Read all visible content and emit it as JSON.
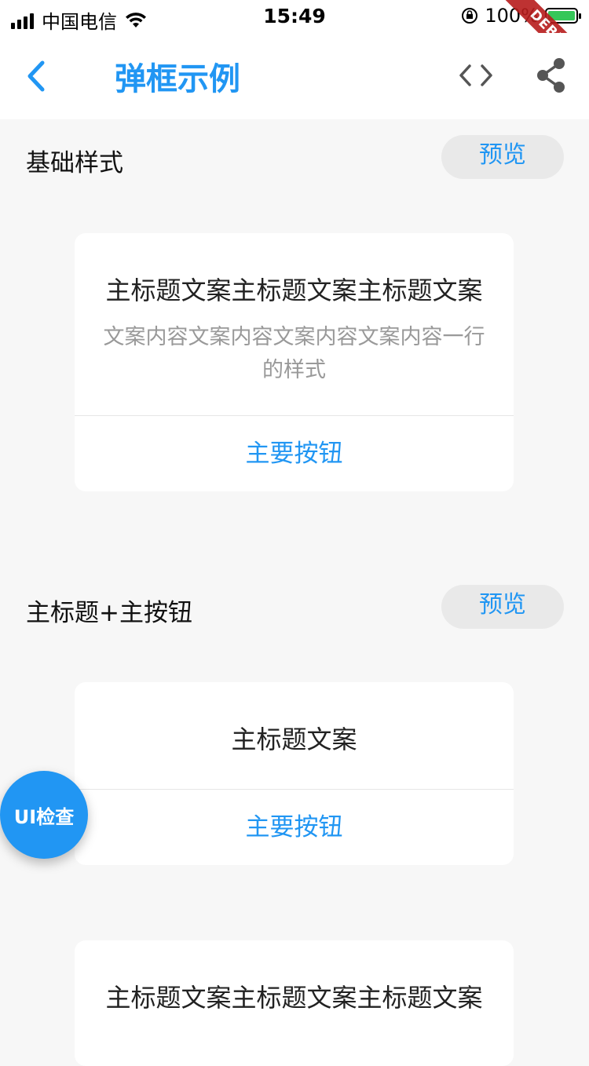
{
  "status_bar": {
    "carrier": "中国电信",
    "time": "15:49",
    "battery_percent": "100%",
    "battery_level": 1.0
  },
  "debug_banner": "DEBUG",
  "nav": {
    "title": "弹框示例",
    "back_icon": "chevron-left-icon",
    "code_icon": "code-icon",
    "share_icon": "share-icon",
    "accent_color": "#2196f3"
  },
  "sections": [
    {
      "title": "基础样式",
      "preview_label": "预览",
      "dialog": {
        "title": "主标题文案主标题文案主标题文案",
        "content": "文案内容文案内容文案内容文案内容一行的样式",
        "primary_button": "主要按钮"
      }
    },
    {
      "title": "主标题+主按钮",
      "preview_label": "预览",
      "dialog": {
        "title": "主标题文案",
        "primary_button": "主要按钮"
      }
    },
    {
      "dialog": {
        "title": "主标题文案主标题文案主标题文案"
      }
    }
  ],
  "fab_label": "UI检查"
}
